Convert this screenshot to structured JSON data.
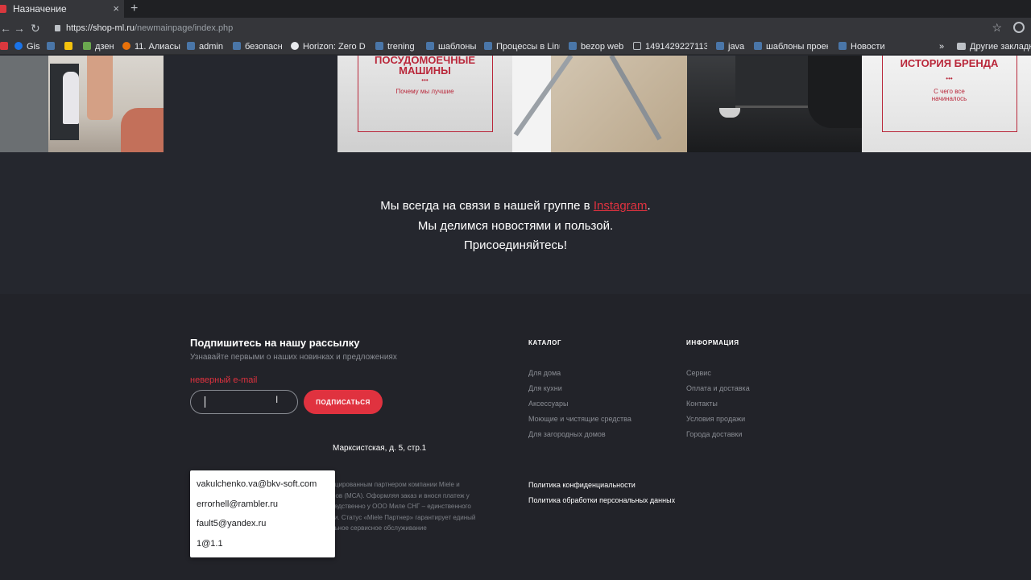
{
  "browser": {
    "tab_title": "Назначение",
    "tab_close": "×",
    "new_tab": "+",
    "url_host": "https://shop-ml.ru",
    "url_path": "/newmainpage/index.php",
    "nav_back": "←",
    "nav_forward": "→",
    "nav_reload": "↻",
    "star": "☆",
    "bookmarks": [
      {
        "label": "Gis",
        "icon": "gis-icon"
      },
      {
        "label": "",
        "icon": "vk-icon"
      },
      {
        "label": "",
        "icon": "yandex-icon"
      },
      {
        "label": "дзен",
        "icon": "h-icon"
      },
      {
        "label": "11. Алиасы",
        "icon": "fire-icon"
      },
      {
        "label": "admin",
        "icon": "vk-icon"
      },
      {
        "label": "безопасн",
        "icon": "vk-icon"
      },
      {
        "label": "Horizon: Zero D",
        "icon": "google-icon"
      },
      {
        "label": "trening",
        "icon": "vk-icon"
      },
      {
        "label": "шаблоны",
        "icon": "vk-icon"
      },
      {
        "label": "Процессы в Linu",
        "icon": "vk-icon"
      },
      {
        "label": "bezop web",
        "icon": "vk-icon"
      },
      {
        "label": "14914292271130",
        "icon": "doc-icon"
      },
      {
        "label": "java",
        "icon": "vk-icon"
      },
      {
        "label": "шаблоны проек",
        "icon": "vk-icon"
      },
      {
        "label": "Новости",
        "icon": "vk-icon"
      }
    ],
    "bookmarks_more": "»",
    "other_bookmarks": "Другие закладк"
  },
  "promo_tiles": {
    "dishwasher": {
      "title_line1": "ПОСУДОМОЕЧНЫЕ",
      "title_line2": "МАШИНЫ",
      "dots": "•••",
      "subtitle": "Почему мы лучшие"
    },
    "brand": {
      "title": "ИСТОРИЯ БРЕНДА",
      "dots": "•••",
      "subtitle_line1": "С чего все",
      "subtitle_line2": "начиналось"
    }
  },
  "instagram": {
    "line1_prefix": "Мы всегда на связи в нашей группе в ",
    "link": "Instagram",
    "line1_suffix": ".",
    "line2": "Мы делимся новостями и пользой.",
    "line3": "Присоединяйтесь!"
  },
  "subscribe": {
    "title": "Подпишитесь на нашу рассылку",
    "description": "Узнавайте первыми о наших новинках и предложениях",
    "error": "неверный e-mail",
    "input_value": "",
    "button_label": "ПОДПИСАТЬСЯ"
  },
  "autocomplete": {
    "items": [
      "vakulchenko.va@bkv-soft.com",
      "errorhell@rambler.ru",
      "fault5@yandex.ru",
      "1@1.1"
    ]
  },
  "address_fragment": "Марксистская, д. 5, стр.1",
  "legal_text": {
    "line1": "ертифицированным партнером компании Miele и",
    "line2": "ров (МСА). Оформляя заказ и внося платеж у",
    "line3": "Miele Партнера, вы заказываете технику непосредственно у ООО Миле СНГ – единственного",
    "line4": "официального импортёра техники Miele в России. Статус «Miele Партнер» гарантирует единый",
    "line5": "уровень цен на всю продукцию Miele и официальное сервисное обслуживание"
  },
  "catalog": {
    "heading": "КАТАЛОГ",
    "items": [
      "Для дома",
      "Для кухни",
      "Аксессуары",
      "Моющие и чистящие средства",
      "Для загородных домов"
    ]
  },
  "info": {
    "heading": "ИНФОРМАЦИЯ",
    "items": [
      "Сервис",
      "Оплата и доставка",
      "Контакты",
      "Условия продажи",
      "Города доставки"
    ]
  },
  "policies": [
    "Политика конфиденциальности",
    "Политика обработки персональных данных"
  ],
  "colors": {
    "accent": "#e0323f",
    "footer_bg": "#222329",
    "page_bg": "#25272e"
  }
}
